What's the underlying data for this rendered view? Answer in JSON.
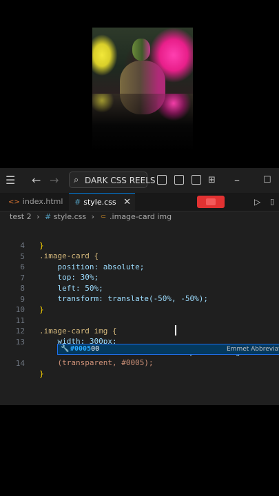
{
  "window": {
    "search_label": "DARK CSS REELS"
  },
  "tabs": [
    {
      "label": "index.html",
      "icon": "html-icon"
    },
    {
      "label": "style.css",
      "icon": "css-icon",
      "active": true
    }
  ],
  "breadcrumb": {
    "folder": "test 2",
    "file": "style.css",
    "symbol": ".image-card img"
  },
  "code_lines": [
    {
      "n": "",
      "text": "}"
    },
    {
      "n": "4",
      "text": ".image-card {"
    },
    {
      "n": "5",
      "text": "    position: absolute;"
    },
    {
      "n": "6",
      "text": "    top: 30%;"
    },
    {
      "n": "7",
      "text": "    left: 50%;"
    },
    {
      "n": "8",
      "text": "    transform: translate(-50%, -50%);"
    },
    {
      "n": "9",
      "text": "}"
    },
    {
      "n": "10",
      "text": ""
    },
    {
      "n": "11",
      "text": ".image-card img {"
    },
    {
      "n": "12",
      "text": "    width: 300px;"
    },
    {
      "n": "13",
      "text": "    -webkit-box-reflect: below 20px linear-gradient"
    },
    {
      "n": "",
      "text": "    (transparent, #0005);"
    },
    {
      "n": "14",
      "text": "}"
    }
  ],
  "suggestion": {
    "label_match": "#0005",
    "label_rest": "00",
    "detail": "Emmet Abbreviation"
  },
  "colors": {
    "accent": "#0078d4",
    "record": "#e23232",
    "suggest_bg": "#04395e"
  }
}
